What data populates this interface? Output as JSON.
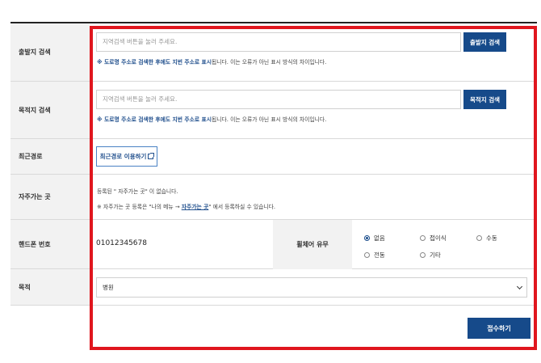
{
  "departure": {
    "label": "출발지 검색",
    "placeholder": "지역검색 버튼을 눌러 주세요.",
    "button": "출발지 검색",
    "notice_accent": "※ 도로명 주소로 검색한 후에도 지번 주소로 표시",
    "notice_rest": "됩니다. 이는 오류가 아닌 표시 방식의 차이입니다."
  },
  "destination": {
    "label": "목적지 검색",
    "placeholder": "지역검색 버튼을 눌러 주세요.",
    "button": "목적지 검색",
    "notice_accent": "※ 도로명 주소로 검색한 후에도 지번 주소로 표시",
    "notice_rest": "됩니다. 이는 오류가 아닌 표시 방식의 차이입니다."
  },
  "recent": {
    "label": "최근경로",
    "button": "최근경로 이용하기"
  },
  "favorites": {
    "label": "자주가는 곳",
    "empty_text": "등록된 \" 자주가는 곳\" 이 없습니다.",
    "hint_before": "※ 자주가는 곳 등록은 \"나의 메뉴 → ",
    "hint_link": "자주가는 곳",
    "hint_after": "\" 에서 등록하실 수 있습니다."
  },
  "phone": {
    "label": "핸드폰 번호",
    "value": "01012345678"
  },
  "wheelchair": {
    "label": "휠체어 유무",
    "options": [
      "없음",
      "접이식",
      "수동",
      "전동",
      "기타"
    ],
    "selected": "없음"
  },
  "purpose": {
    "label": "목적",
    "selected": "병원"
  },
  "submit_label": "접수하기"
}
